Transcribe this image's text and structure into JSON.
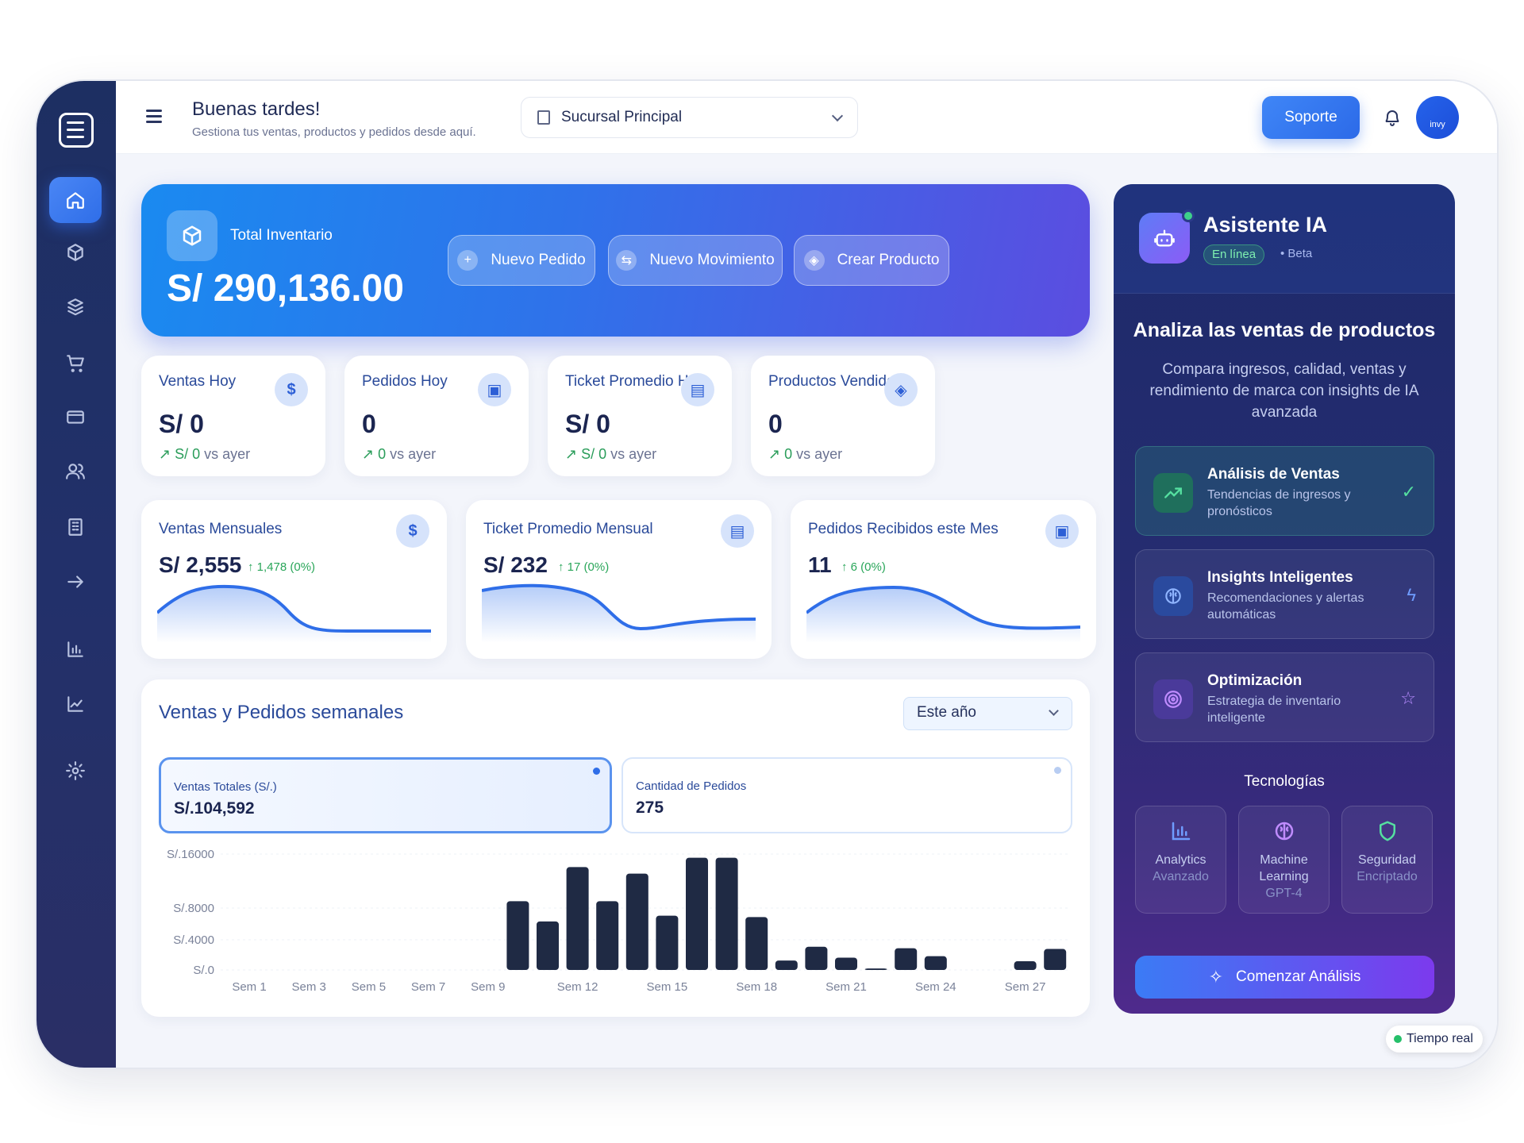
{
  "header": {
    "greeting": "Buenas tardes!",
    "subtitle": "Gestiona tus ventas, productos y pedidos desde aquí.",
    "branch": "Sucursal Principal",
    "support": "Soporte",
    "avatar": "invy"
  },
  "sidebar": {
    "items": [
      {
        "icon": "home-icon",
        "active": true
      },
      {
        "icon": "box-icon"
      },
      {
        "icon": "boxes-icon"
      },
      {
        "icon": "cart-icon"
      },
      {
        "icon": "card-icon"
      },
      {
        "icon": "users-icon"
      },
      {
        "icon": "building-icon"
      },
      {
        "icon": "arrow-right-icon"
      },
      {
        "icon": "bar-chart-icon"
      },
      {
        "icon": "line-chart-icon"
      },
      {
        "icon": "settings-icon"
      }
    ]
  },
  "hero": {
    "label": "Total Inventario",
    "value": "S/ 290,136.00",
    "buttons": [
      "Nuevo Pedido",
      "Nuevo Movimiento",
      "Crear Producto"
    ]
  },
  "stats": [
    {
      "label": "Ventas Hoy",
      "value": "S/ 0",
      "cmp_val": "S/ 0",
      "cmp_txt": "vs ayer",
      "icon": "$"
    },
    {
      "label": "Pedidos Hoy",
      "value": "0",
      "cmp_val": "0",
      "cmp_txt": "vs ayer",
      "icon": "▣"
    },
    {
      "label": "Ticket Promedio Hoy",
      "value": "S/ 0",
      "cmp_val": "S/ 0",
      "cmp_txt": "vs ayer",
      "icon": "▤"
    },
    {
      "label": "Productos Vendidos",
      "value": "0",
      "cmp_val": "0",
      "cmp_txt": "vs ayer",
      "icon": "◈"
    }
  ],
  "monthly": [
    {
      "label": "Ventas Mensuales",
      "value": "S/ 2,555",
      "change": "↑ 1,478 (0%)",
      "icon": "$"
    },
    {
      "label": "Ticket Promedio Mensual",
      "value": "S/ 232",
      "change": "↑ 17 (0%)",
      "icon": "▤"
    },
    {
      "label": "Pedidos Recibidos este Mes",
      "value": "11",
      "change": "↑ 6 (0%)",
      "icon": "▣"
    }
  ],
  "weekly": {
    "title": "Ventas y Pedidos semanales",
    "period": "Este año",
    "metric1_label": "Ventas Totales (S/.)",
    "metric1_value": "S/.104,592",
    "metric2_label": "Cantidad de Pedidos",
    "metric2_value": "275"
  },
  "chart_data": {
    "type": "bar",
    "title": "Ventas y Pedidos semanales",
    "y_ticks": [
      "S/.16000",
      "S/.8000",
      "S/.4000",
      "S/.0"
    ],
    "x_ticks": [
      "Sem 1",
      "Sem 3",
      "Sem 5",
      "Sem 7",
      "Sem 9",
      "Sem 12",
      "Sem 15",
      "Sem 18",
      "Sem 21",
      "Sem 24",
      "Sem 27"
    ],
    "categories": [
      "Sem 1",
      "Sem 2",
      "Sem 3",
      "Sem 4",
      "Sem 5",
      "Sem 6",
      "Sem 7",
      "Sem 8",
      "Sem 9",
      "Sem 10",
      "Sem 11",
      "Sem 12",
      "Sem 13",
      "Sem 14",
      "Sem 15",
      "Sem 16",
      "Sem 17",
      "Sem 18",
      "Sem 19",
      "Sem 20",
      "Sem 21",
      "Sem 22",
      "Sem 23",
      "Sem 24",
      "Sem 25",
      "Sem 26",
      "Sem 27",
      "Sem 28"
    ],
    "values": [
      0,
      0,
      0,
      0,
      0,
      0,
      0,
      0,
      0,
      9500,
      6700,
      14200,
      9500,
      13300,
      7500,
      15500,
      15500,
      7300,
      1300,
      3200,
      1700,
      200,
      3000,
      1900,
      0,
      0,
      1200,
      2900
    ]
  },
  "ai": {
    "title": "Asistente IA",
    "online": "En línea",
    "beta": "• Beta",
    "heading": "Analiza las ventas de productos",
    "desc": "Compara ingresos, calidad, ventas y rendimiento de marca con insights de IA avanzada",
    "features": [
      {
        "title": "Análisis de Ventas",
        "desc": "Tendencias de ingresos y pronósticos"
      },
      {
        "title": "Insights Inteligentes",
        "desc": "Recomendaciones y alertas automáticas"
      },
      {
        "title": "Optimización",
        "desc": "Estrategia de inventario inteligente"
      }
    ],
    "tech_title": "Tecnologías",
    "techs": [
      {
        "name": "Analytics",
        "sub": "Avanzado"
      },
      {
        "name": "Machine Learning",
        "sub": "GPT-4"
      },
      {
        "name": "Seguridad",
        "sub": "Encriptado"
      }
    ],
    "cta": "Comenzar Análisis"
  },
  "realtime": "Tiempo real",
  "colors": {
    "accent": "#2f6ee8",
    "success": "#2aa65a",
    "bar": "#1f2a44"
  }
}
